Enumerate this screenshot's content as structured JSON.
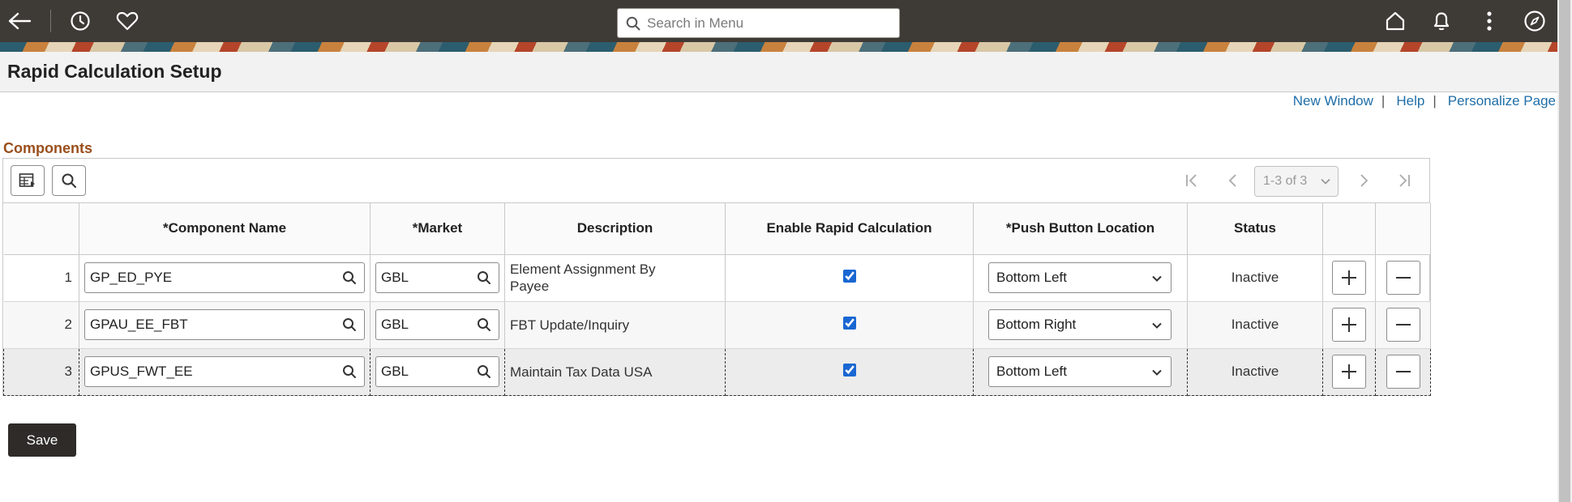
{
  "topbar": {
    "search_placeholder": "Search in Menu"
  },
  "page": {
    "title": "Rapid Calculation Setup"
  },
  "links": {
    "new_window": "New Window",
    "help": "Help",
    "personalize": "Personalize Page",
    "separator": "|"
  },
  "section": {
    "title": "Components"
  },
  "pager": {
    "range": "1-3 of 3"
  },
  "columns": {
    "component": "*Component Name",
    "market": "*Market",
    "description": "Description",
    "enable": "Enable Rapid Calculation",
    "location": "*Push Button Location",
    "status": "Status"
  },
  "rows": [
    {
      "num": "1",
      "component": "GP_ED_PYE",
      "market": "GBL",
      "description": "Element Assignment By Payee",
      "enabled": true,
      "location": "Bottom Left",
      "status": "Inactive"
    },
    {
      "num": "2",
      "component": "GPAU_EE_FBT",
      "market": "GBL",
      "description": "FBT Update/Inquiry",
      "enabled": true,
      "location": "Bottom Right",
      "status": "Inactive"
    },
    {
      "num": "3",
      "component": "GPUS_FWT_EE",
      "market": "GBL",
      "description": "Maintain Tax Data USA",
      "enabled": true,
      "location": "Bottom Left",
      "status": "Inactive"
    }
  ],
  "actions": {
    "save": "Save"
  },
  "colors": {
    "topbar": "#3e3a36",
    "link": "#1f6ea8",
    "section_title": "#9a4e1c",
    "save_button": "#2e2b28"
  }
}
